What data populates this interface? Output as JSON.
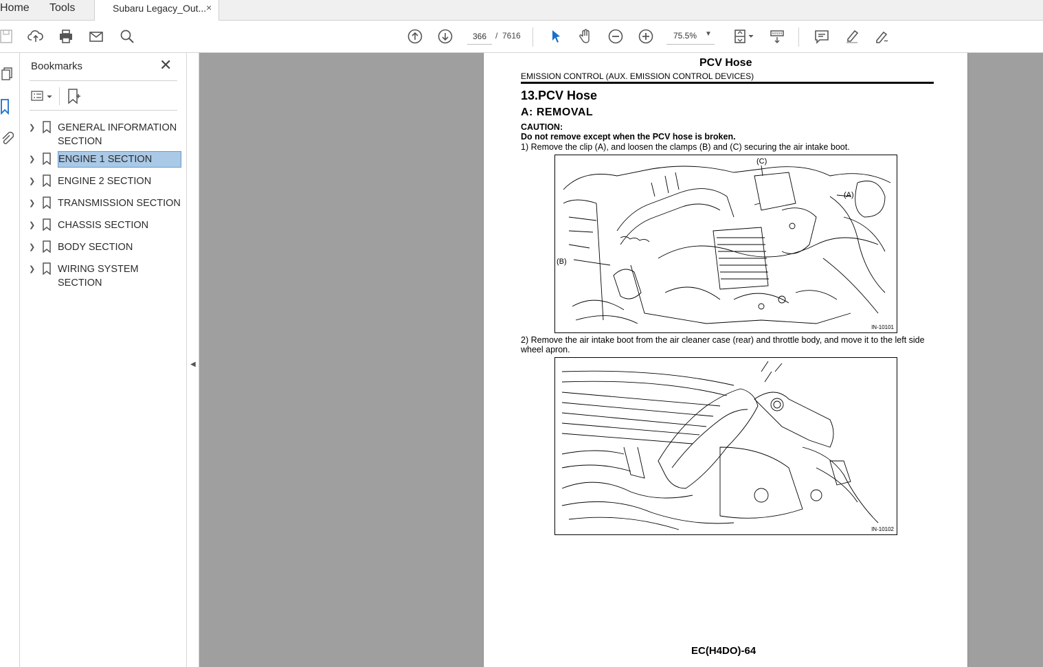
{
  "menu": {
    "home": "Home",
    "tools": "Tools"
  },
  "tab": {
    "title": "Subaru Legacy_Out...",
    "close": "×"
  },
  "toolbar": {
    "current_page": "366",
    "total_pages": "7616",
    "zoom": "75.5%"
  },
  "bookmarks": {
    "title": "Bookmarks",
    "items": [
      {
        "label": "GENERAL INFORMATION SECTION",
        "selected": false
      },
      {
        "label": "ENGINE 1 SECTION",
        "selected": true
      },
      {
        "label": "ENGINE 2 SECTION",
        "selected": false
      },
      {
        "label": "TRANSMISSION SECTION",
        "selected": false
      },
      {
        "label": "CHASSIS SECTION",
        "selected": false
      },
      {
        "label": "BODY SECTION",
        "selected": false
      },
      {
        "label": "WIRING SYSTEM SECTION",
        "selected": false
      }
    ]
  },
  "document": {
    "title": "PCV Hose",
    "subtitle": "EMISSION CONTROL (AUX. EMISSION CONTROL DEVICES)",
    "heading": "13.PCV Hose",
    "subheading": "A:  REMOVAL",
    "caution_label": "CAUTION:",
    "caution_text": "Do not remove except when the PCV hose is broken.",
    "step1": "1) Remove the clip (A), and loosen the clamps (B) and (C) securing the air intake boot.",
    "figure1": {
      "code": "IN-10101",
      "label_a": "(A)",
      "label_b": "(B)",
      "label_c": "(C)"
    },
    "step2": "2) Remove the air intake boot from the air cleaner case (rear) and throttle body, and move it to the left side wheel apron.",
    "figure2": {
      "code": "IN-10102"
    },
    "footer": "EC(H4DO)-64"
  },
  "colors": {
    "viewer_bg": "#9f9f9f",
    "selection": "#a9c9e6",
    "accent": "#1a6fc9"
  }
}
